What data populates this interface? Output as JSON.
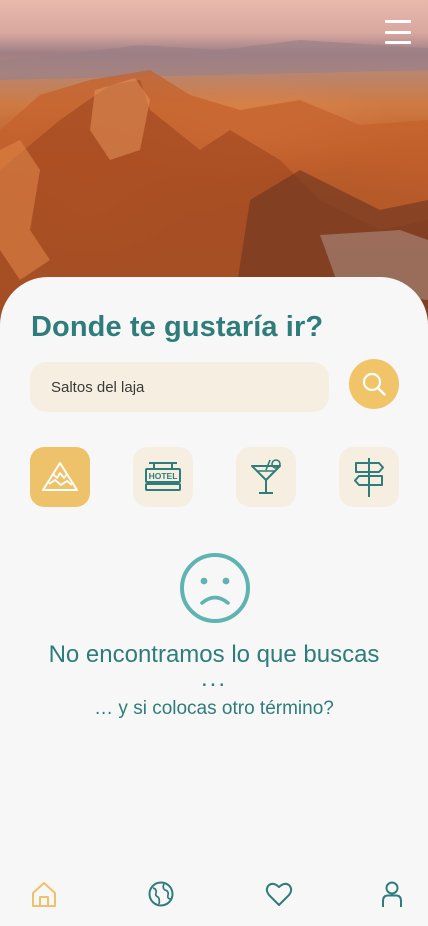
{
  "colors": {
    "accent": "#eec26a",
    "teal": "#2e7d7b",
    "chip_bg": "#f6efe1",
    "sheet_bg": "#f7f7f7"
  },
  "header": {
    "menu_icon": "hamburger-menu-icon"
  },
  "search": {
    "title": "Donde te gustaría ir?",
    "value": "Saltos del laja",
    "button_icon": "search-icon"
  },
  "categories": [
    {
      "icon": "mountain-icon",
      "active": true
    },
    {
      "icon": "hotel-sign-icon",
      "label": "HOTEL",
      "active": false
    },
    {
      "icon": "cocktail-icon",
      "active": false
    },
    {
      "icon": "signpost-icon",
      "active": false
    }
  ],
  "empty_state": {
    "icon": "sad-face-icon",
    "title": "No encontramos lo que buscas",
    "dots": "...",
    "subtitle": "… y si colocas otro término?"
  },
  "bottom_nav": [
    {
      "icon": "home-icon",
      "active": true
    },
    {
      "icon": "globe-icon",
      "active": false
    },
    {
      "icon": "heart-icon",
      "active": false
    },
    {
      "icon": "user-icon",
      "active": false
    }
  ]
}
